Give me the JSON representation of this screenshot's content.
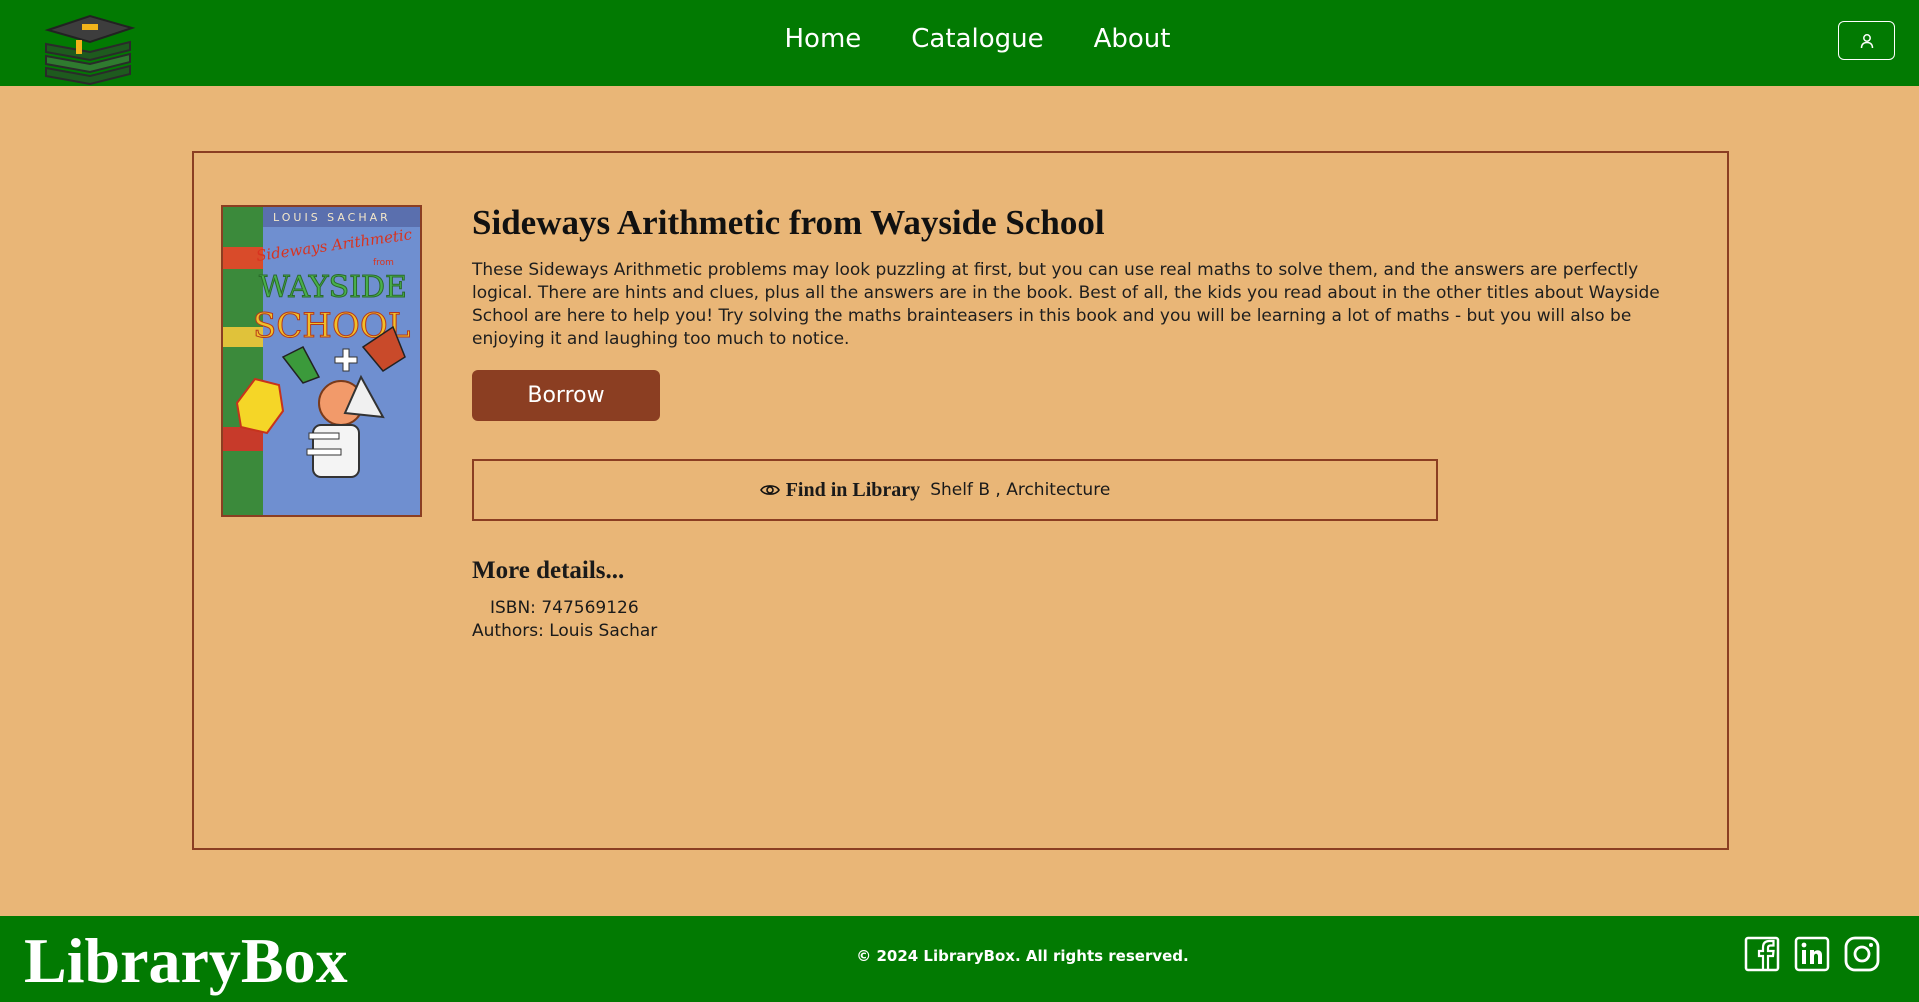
{
  "nav": {
    "links": [
      "Home",
      "Catalogue",
      "About"
    ]
  },
  "book": {
    "title": "Sideways Arithmetic from Wayside School",
    "description": "These Sideways Arithmetic problems may look puzzling at first, but you can use real maths to solve them, and the answers are perfectly logical. There are hints and clues, plus all the answers are in the book. Best of all, the kids you read about in the other titles about Wayside School are here to help you! Try solving the maths brainteasers in this book and you will be learning a lot of maths - but you will also be enjoying it and laughing too much to notice.",
    "borrow_label": "Borrow",
    "cover": {
      "author": "LOUIS SACHAR",
      "line1": "Sideways Arithmetic",
      "line2": "from",
      "line3": "WAYSIDE",
      "line4": "SCHOOL"
    }
  },
  "location": {
    "label": "Find in Library",
    "value": "Shelf B , Architecture"
  },
  "details": {
    "heading": "More details...",
    "isbn": "ISBN: 747569126",
    "authors": "Authors: Louis Sachar"
  },
  "footer": {
    "brand": "LibraryBox",
    "copyright": "© 2024 LibraryBox. All rights reserved."
  },
  "colors": {
    "nav_bg": "#027a02",
    "page_bg": "#e9b677",
    "accent": "#8b3e22",
    "text": "#ffffff"
  },
  "icons": [
    "library-logo",
    "user-icon",
    "eye-icon",
    "facebook-icon",
    "linkedin-icon",
    "instagram-icon"
  ]
}
